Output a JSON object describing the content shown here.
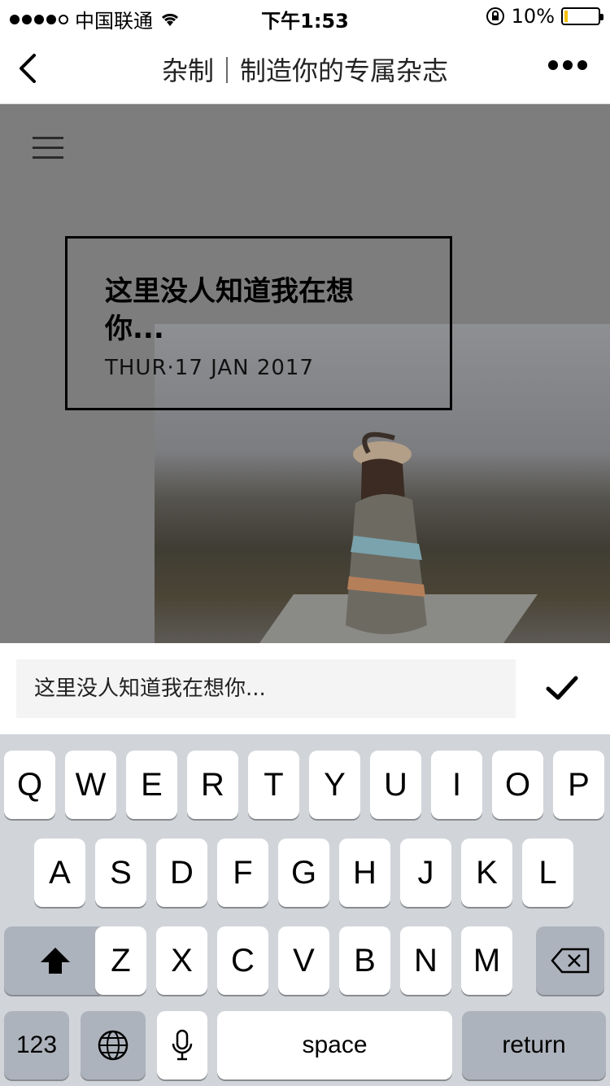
{
  "status_bar": {
    "carrier": "中国联通",
    "time": "下午1:53",
    "battery": "10%"
  },
  "nav": {
    "title": "杂制｜制造你的专属杂志"
  },
  "card": {
    "headline": "这里没人知道我在想你...",
    "date": "THUR·17 JAN 2017"
  },
  "input": {
    "value": "这里没人知道我在想你..."
  },
  "keyboard": {
    "row1": [
      "Q",
      "W",
      "E",
      "R",
      "T",
      "Y",
      "U",
      "I",
      "O",
      "P"
    ],
    "row2": [
      "A",
      "S",
      "D",
      "F",
      "G",
      "H",
      "J",
      "K",
      "L"
    ],
    "row3": [
      "Z",
      "X",
      "C",
      "V",
      "B",
      "N",
      "M"
    ],
    "numbers_label": "123",
    "space_label": "space",
    "return_label": "return"
  },
  "icons": {
    "back": "chevron-left-icon",
    "more": "more-dots-icon",
    "menu": "hamburger-menu-icon",
    "confirm": "checkmark-icon",
    "shift": "shift-icon",
    "delete": "backspace-icon",
    "globe": "globe-icon",
    "mic": "microphone-icon"
  },
  "colors": {
    "overlay": "#7d7d7d",
    "keyboard_bg": "#d1d4d9",
    "battery_fill": "#f5c000"
  }
}
